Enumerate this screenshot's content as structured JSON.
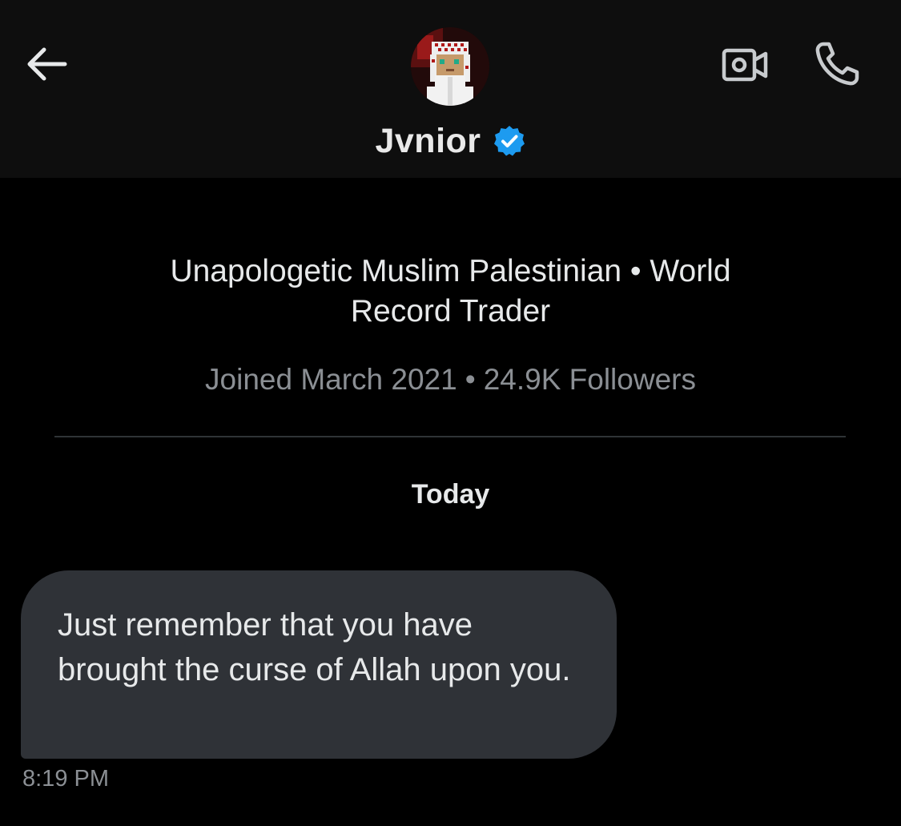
{
  "header": {
    "conversation_name": "Jvnior",
    "back_icon": "arrow-left-icon",
    "avatar": "pixel-art-avatar",
    "verified_icon": "verified-badge-icon",
    "video_icon": "video-camera-icon",
    "call_icon": "phone-icon",
    "verified_color": "#1d9bf0"
  },
  "profile": {
    "bio_line1": "Unapologetic Muslim Palestinian • World",
    "bio_line2": "Record Trader",
    "joined": "Joined March 2021",
    "separator": "•",
    "followers": "24.9K Followers"
  },
  "conversation": {
    "day_label": "Today",
    "messages": [
      {
        "text": "Just remember that you have brought the curse of Allah upon you.",
        "time": "8:19 PM",
        "bubble_color": "#2f3237"
      }
    ]
  }
}
